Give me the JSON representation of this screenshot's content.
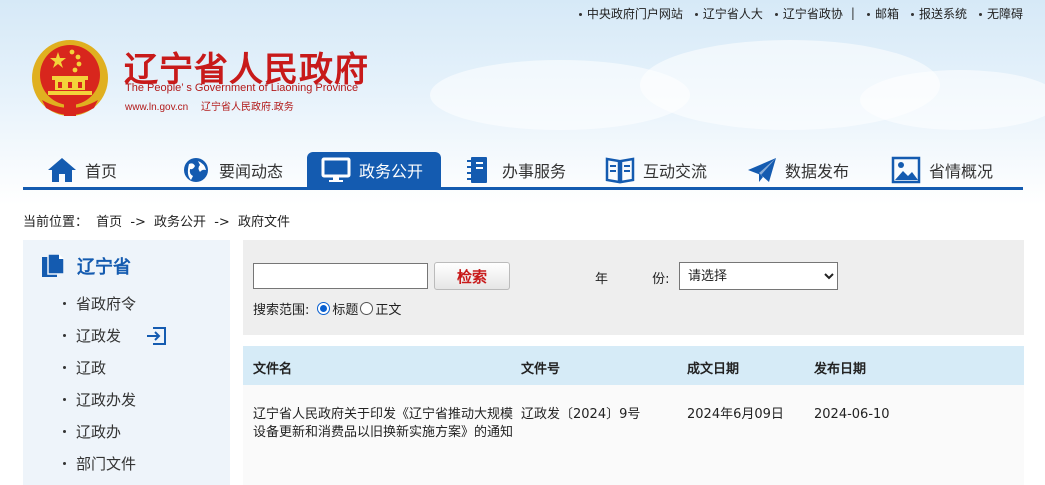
{
  "top_links": [
    "中央政府门户网站",
    "辽宁省人大",
    "辽宁省政协",
    "邮箱",
    "报送系统",
    "无障碍"
  ],
  "top_sep": "|",
  "site": {
    "title": "辽宁省人民政府",
    "en": "The People’ s Government of Liaoning Province",
    "url": "www.ln.gov.cn",
    "url_cn": "辽宁省人民政府.政务"
  },
  "nav": [
    {
      "label": "首页",
      "icon": "home-icon"
    },
    {
      "label": "要闻动态",
      "icon": "globe-icon"
    },
    {
      "label": "政务公开",
      "icon": "monitor-icon",
      "active": true
    },
    {
      "label": "办事服务",
      "icon": "notebook-icon"
    },
    {
      "label": "互动交流",
      "icon": "book-icon"
    },
    {
      "label": "数据发布",
      "icon": "paper-plane-icon"
    },
    {
      "label": "省情概况",
      "icon": "picture-icon"
    }
  ],
  "breadcrumb": {
    "prefix": "当前位置：",
    "items": [
      "首页",
      "->",
      "政务公开",
      "->",
      "政府文件"
    ]
  },
  "sidebar": {
    "title": "辽宁省",
    "items": [
      "省政府令",
      "辽政发",
      "辽政",
      "辽政办发",
      "辽政办",
      "部门文件"
    ]
  },
  "search": {
    "input_value": "",
    "button_label": "检索",
    "year_label_a": "年",
    "year_label_b": "份:",
    "year_selected": "请选择",
    "range_label": "搜索范围:",
    "range_options": [
      "标题",
      "正文"
    ]
  },
  "table": {
    "headers": [
      "文件名",
      "文件号",
      "成文日期",
      "发布日期"
    ],
    "rows": [
      {
        "name": "辽宁省人民政府关于印发《辽宁省推动大规模设备更新和消费品以旧换新实施方案》的通知",
        "number": "辽政发〔2024〕9号",
        "written": "2024年6月09日",
        "published": "2024-06-10"
      }
    ]
  },
  "colors": {
    "nav_active": "#145bb0",
    "title_red": "#c81a1a",
    "sidebar_bg": "#eef4fa",
    "table_head_bg": "#d6ebf7"
  }
}
